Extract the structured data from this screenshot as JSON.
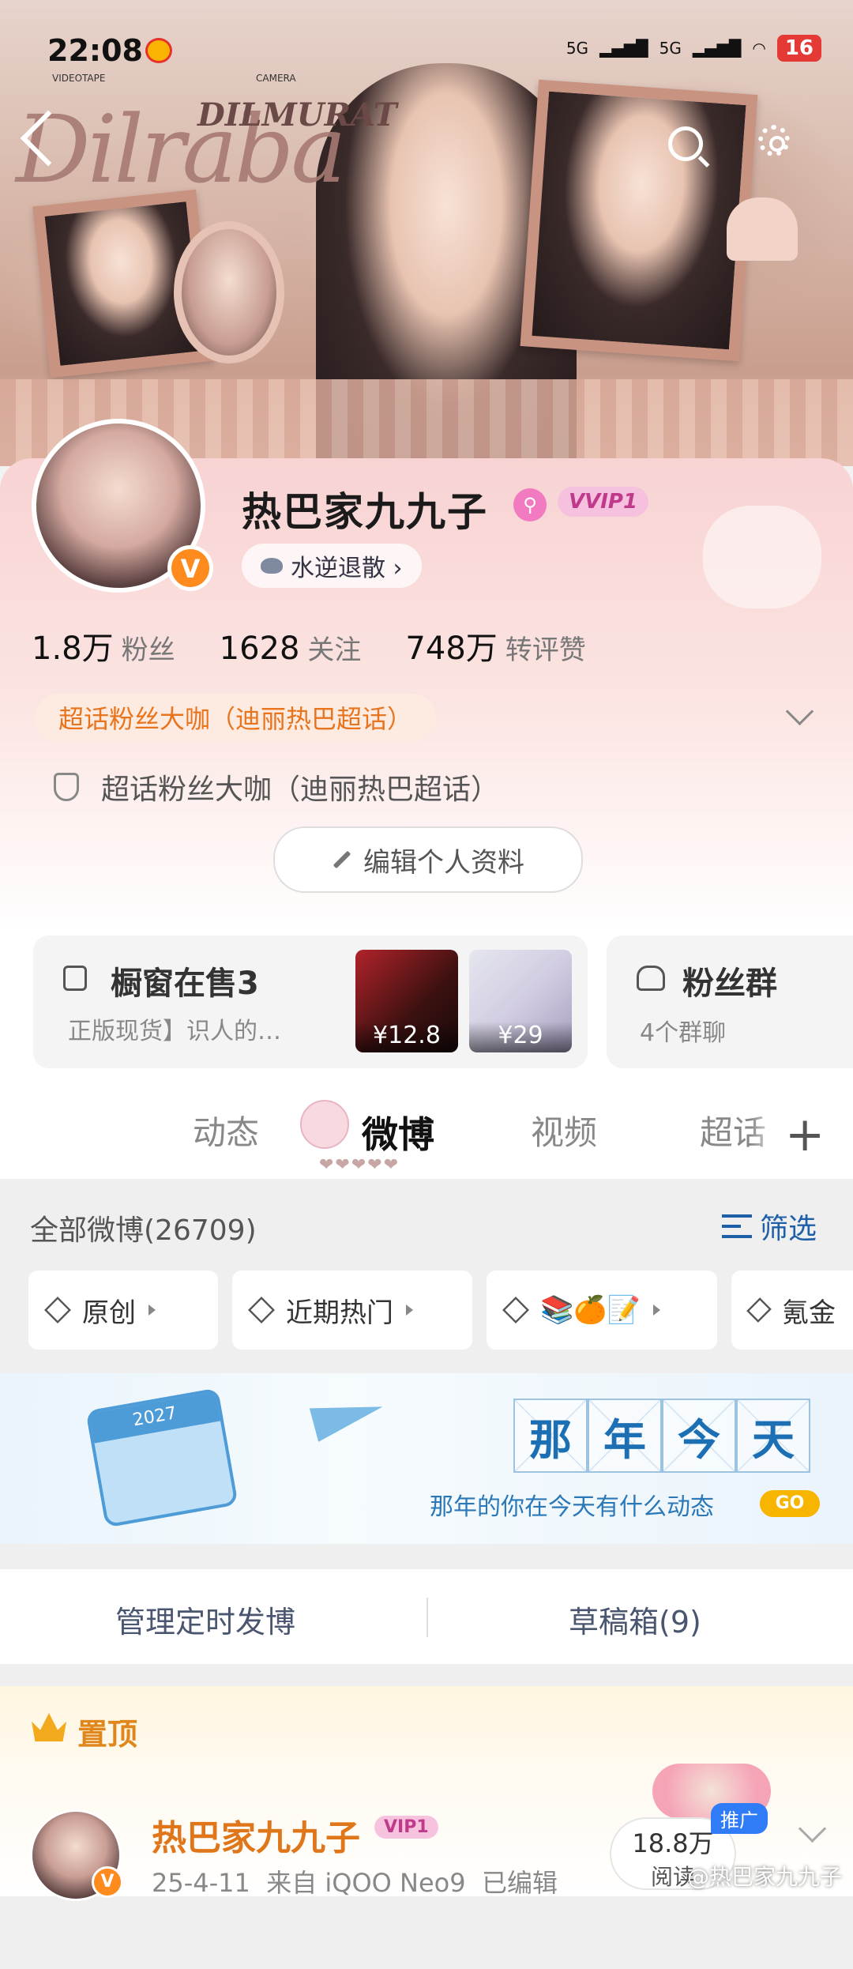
{
  "status_bar": {
    "time": "22:08",
    "signal1": "5G",
    "signal2": "5G",
    "battery": "16"
  },
  "cover": {
    "brand": "Dilraba",
    "brand_sub": "DILMURAT",
    "top_left_label": "VIDEOTAPE",
    "top_mid_label": "CAMERA"
  },
  "profile": {
    "name": "热巴家九九子",
    "vip_badge": "VVIP1",
    "sub_pill": "水逆退散 ›",
    "avatar_v": "V",
    "stats": [
      {
        "num": "1.8万",
        "label": "粉丝"
      },
      {
        "num": "1628",
        "label": "关注"
      },
      {
        "num": "748万",
        "label": "转评赞"
      }
    ],
    "honor_pill": "超话粉丝大咖（迪丽热巴超话）",
    "honor_text": "超话粉丝大咖（迪丽热巴超话）",
    "edit_label": "编辑个人资料"
  },
  "shop": {
    "title": "橱窗在售3",
    "subtitle": "正版现货】识人的…",
    "products": [
      {
        "price": "¥12.8"
      },
      {
        "price": "¥29"
      }
    ]
  },
  "fans_group": {
    "title": "粉丝群",
    "subtitle": "4个群聊"
  },
  "tabs": [
    "动态",
    "微博",
    "视频",
    "超话"
  ],
  "tab_hearts": "❤❤❤❤❤",
  "feed": {
    "all_count": "全部微博(26709)",
    "filter_label": "筛选",
    "chips": [
      "原创",
      "近期热门",
      "📚🍊📝",
      "氪金"
    ]
  },
  "memory": {
    "calendar_year": "2027",
    "title_chars": [
      "那",
      "年",
      "今",
      "天"
    ],
    "subtitle": "那年的你在今天有什么动态",
    "go": "GO"
  },
  "manage": {
    "scheduled": "管理定时发博",
    "drafts": "草稿箱(9)"
  },
  "pinned": {
    "label": "置顶",
    "author": "热巴家九九子",
    "author_vip": "VIP1",
    "avatar_v": "V",
    "meta": "25-4-11  来自 iQOO Neo9  已编辑",
    "reads_num": "18.8万",
    "reads_label": "阅读",
    "promo": "推广",
    "watermark": "@热巴家九九子"
  }
}
